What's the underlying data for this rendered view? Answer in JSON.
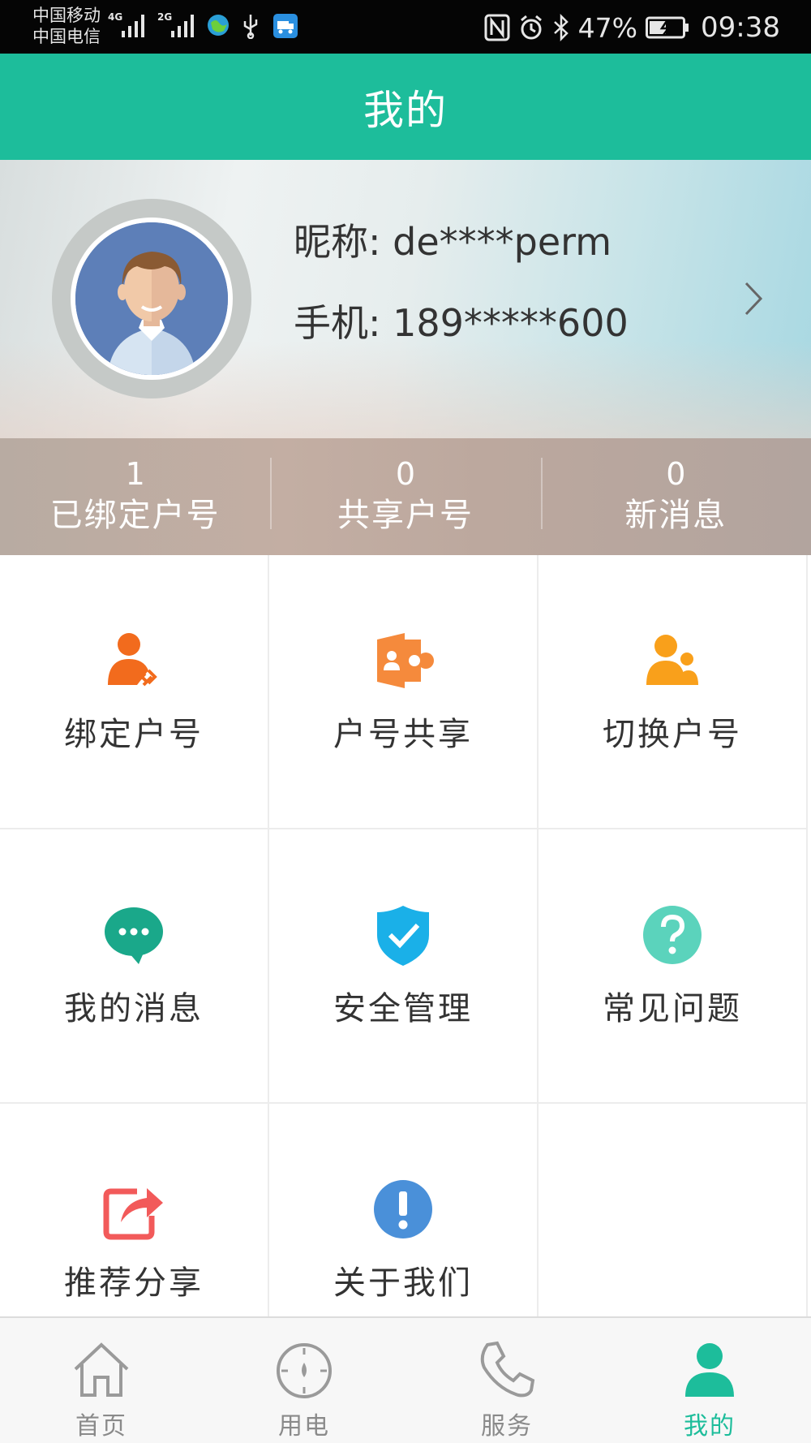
{
  "status_bar": {
    "carrier_1": "中国移动",
    "carrier_2": "中国电信",
    "net_1": "4G",
    "net_2": "2G",
    "battery": "47%",
    "time": "09:38"
  },
  "header": {
    "title": "我的"
  },
  "profile": {
    "nickname_label": "昵称:",
    "nickname": "de****perm",
    "phone_label": "手机:",
    "phone": "189*****600"
  },
  "stats": [
    {
      "value": "1",
      "label": "已绑定户号"
    },
    {
      "value": "0",
      "label": "共享户号"
    },
    {
      "value": "0",
      "label": "新消息"
    }
  ],
  "menu": [
    {
      "label": "绑定户号",
      "icon": "bind-account-icon",
      "color": "#f26b1d"
    },
    {
      "label": "户号共享",
      "icon": "share-account-icon",
      "color": "#f58a3c"
    },
    {
      "label": "切换户号",
      "icon": "switch-account-icon",
      "color": "#f9a01b"
    },
    {
      "label": "我的消息",
      "icon": "message-icon",
      "color": "#1aa88a"
    },
    {
      "label": "安全管理",
      "icon": "security-shield-icon",
      "color": "#1ab0e8"
    },
    {
      "label": "常见问题",
      "icon": "question-icon",
      "color": "#5bd3bc"
    },
    {
      "label": "推荐分享",
      "icon": "recommend-share-icon",
      "color": "#f25a5a"
    },
    {
      "label": "关于我们",
      "icon": "about-info-icon",
      "color": "#4a90d9"
    }
  ],
  "bottom_nav": [
    {
      "label": "首页",
      "icon": "home-icon",
      "active": false
    },
    {
      "label": "用电",
      "icon": "meter-icon",
      "active": false
    },
    {
      "label": "服务",
      "icon": "phone-icon",
      "active": false
    },
    {
      "label": "我的",
      "icon": "profile-icon",
      "active": true
    }
  ],
  "colors": {
    "accent": "#1dbd9b",
    "status_bar_bg": "#050505",
    "text": "#333333",
    "inactive_nav": "#8a8a8a"
  }
}
